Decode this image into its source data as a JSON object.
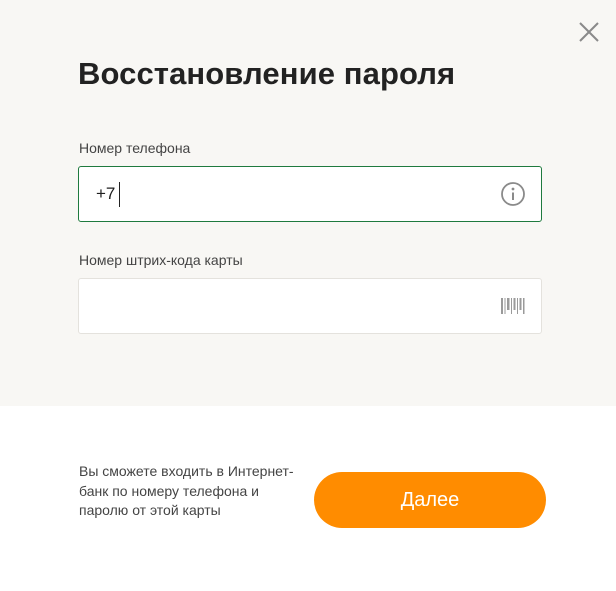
{
  "dialog": {
    "title": "Восстановление пароля",
    "close_icon": "close-icon"
  },
  "form": {
    "phone": {
      "label": "Номер телефона",
      "prefix": "+7",
      "value": "",
      "icon": "info-icon"
    },
    "barcode": {
      "label": "Номер штрих-кода карты",
      "value": "",
      "icon": "barcode-icon"
    }
  },
  "footer": {
    "hint": "Вы сможете входить в Интернет-банк по номеру телефона и паролю от этой карты",
    "next_label": "Далее"
  },
  "colors": {
    "panel_background": "#f8f7f4",
    "focused_border": "#1f7a3e",
    "primary_button": "#ff8c00"
  }
}
